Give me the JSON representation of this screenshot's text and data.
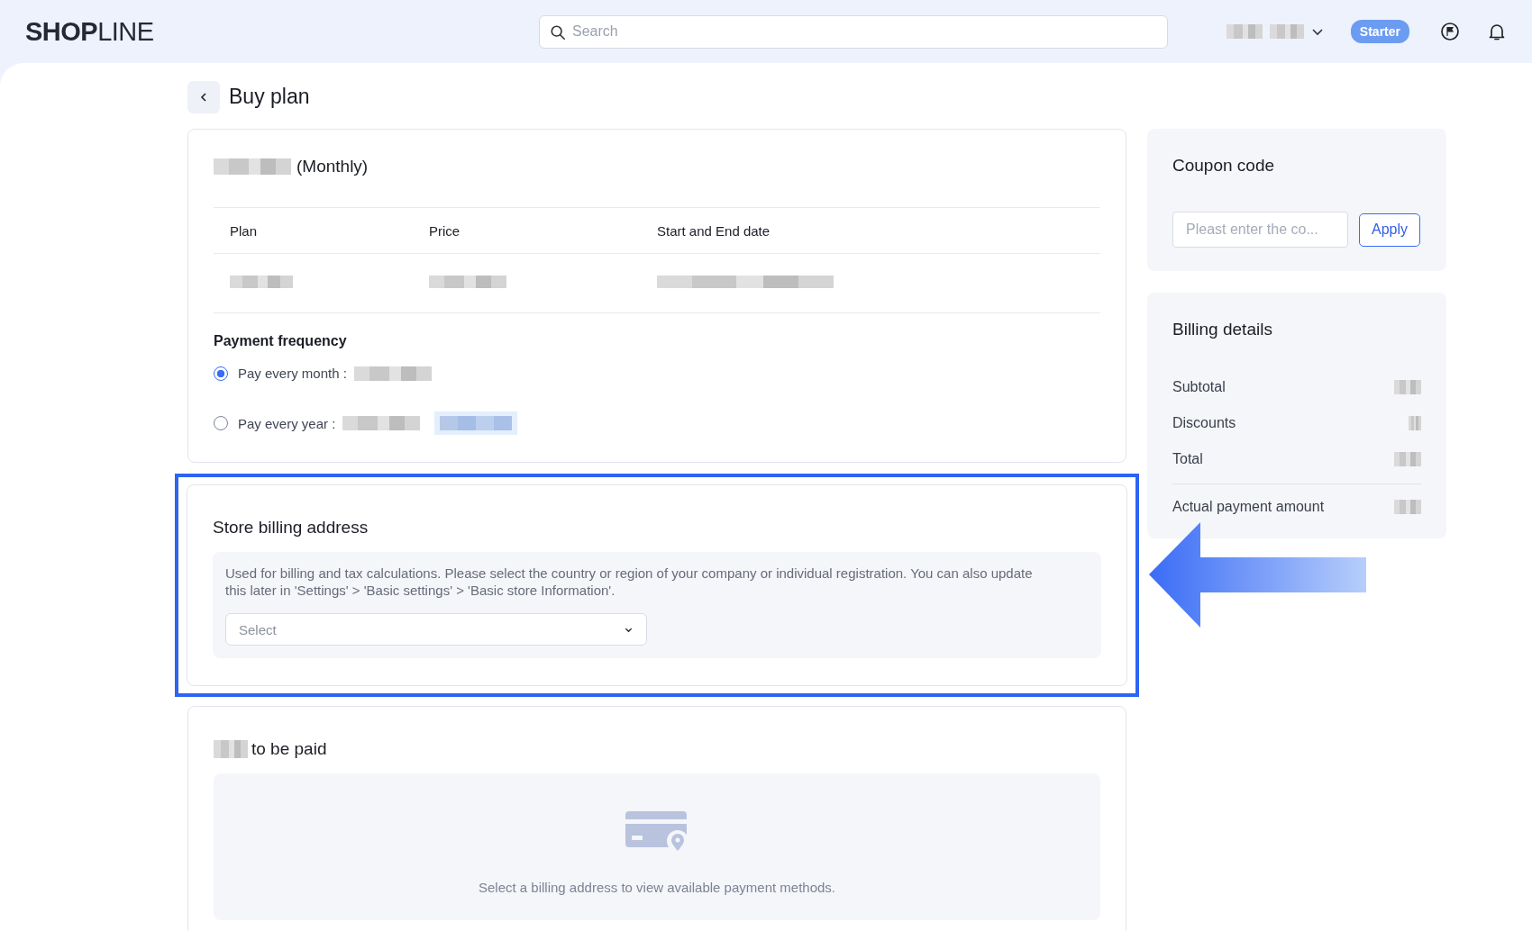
{
  "header": {
    "logo": "**SHOP**LINE",
    "search": {
      "placeholder": "Search"
    },
    "plan_badge": "Starter"
  },
  "page": {
    "title": "Buy plan"
  },
  "plan_card": {
    "title_suffix": "(Monthly)",
    "columns": [
      "Plan",
      "Price",
      "Start and End date"
    ],
    "frequency_label": "Payment frequency",
    "options": [
      {
        "label": "Pay every month :",
        "selected": true
      },
      {
        "label": "Pay every year :",
        "selected": false
      }
    ]
  },
  "billing_address": {
    "title": "Store billing address",
    "note": "Used for billing and tax calculations. Please select the country or region of your company or individual registration. You can also update this later in 'Settings' > 'Basic settings' > 'Basic store Information'.",
    "select": {
      "placeholder": "Select"
    }
  },
  "payment": {
    "title_suffix": "to be paid",
    "empty_text": "Select a billing address to view available payment methods."
  },
  "coupon": {
    "title": "Coupon code",
    "placeholder": "Pleast enter the co...",
    "button": "Apply"
  },
  "billing_details": {
    "title": "Billing details",
    "rows": [
      "Subtotal",
      "Discounts",
      "Total"
    ],
    "total_label": "Actual payment amount"
  }
}
